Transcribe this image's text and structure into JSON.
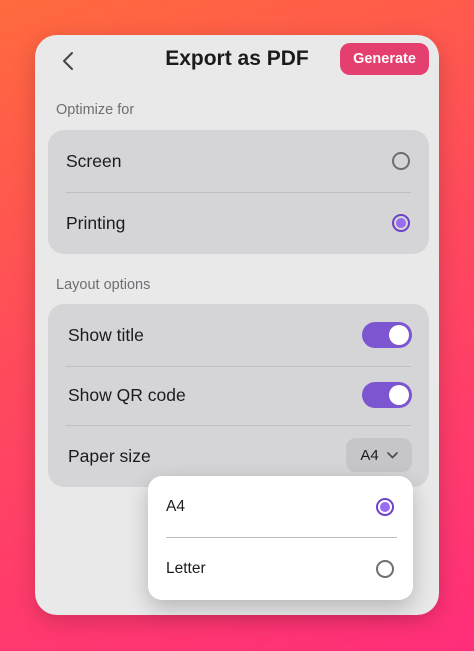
{
  "header": {
    "back_icon": "chevron-left-icon",
    "title": "Export as PDF",
    "generate_label": "Generate"
  },
  "optimize": {
    "label": "Optimize for",
    "options": [
      {
        "label": "Screen",
        "selected": false
      },
      {
        "label": "Printing",
        "selected": true
      }
    ]
  },
  "layout": {
    "label": "Layout options",
    "show_title": {
      "label": "Show title",
      "on": true
    },
    "show_qr": {
      "label": "Show QR code",
      "on": true
    },
    "paper_size": {
      "label": "Paper size",
      "value": "A4",
      "icon": "chevron-down-icon"
    }
  },
  "paper_menu": {
    "options": [
      {
        "label": "A4",
        "selected": true
      },
      {
        "label": "Letter",
        "selected": false
      }
    ]
  },
  "colors": {
    "accent": "#7c55d1",
    "generate": "#e43f6f",
    "card": "#e9e9ea",
    "group": "#d5d5d8"
  }
}
